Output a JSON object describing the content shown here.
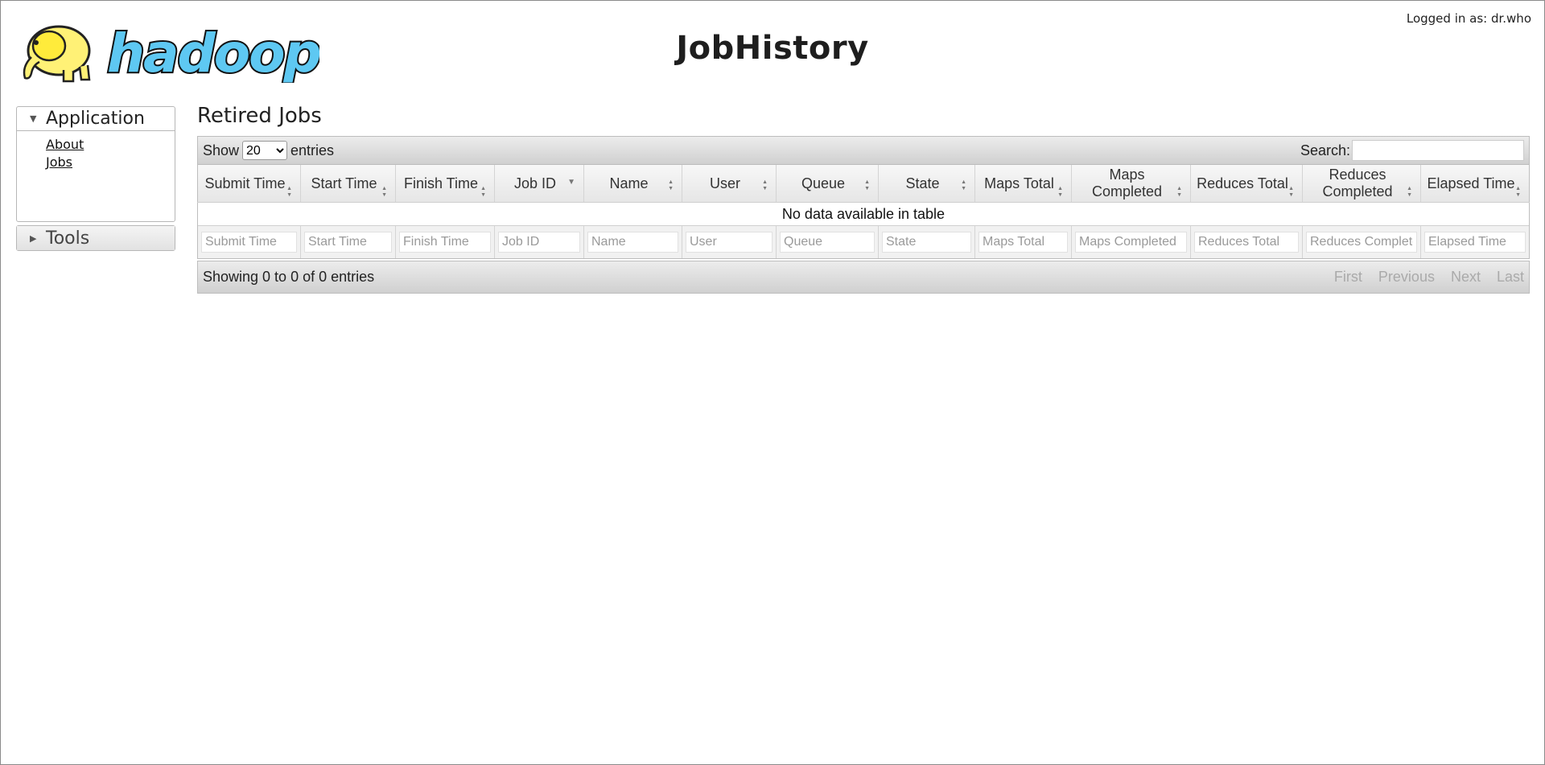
{
  "header": {
    "title": "JobHistory",
    "login": "Logged in as: dr.who",
    "logo_text": "hadoop"
  },
  "nav": {
    "application": {
      "label": "Application",
      "links": [
        "About",
        "Jobs"
      ]
    },
    "tools": {
      "label": "Tools"
    }
  },
  "main": {
    "title": "Retired Jobs",
    "length_prefix": "Show",
    "length_value": "20",
    "length_suffix": "entries",
    "search_label": "Search:",
    "search_value": "",
    "columns": [
      "Submit Time",
      "Start Time",
      "Finish Time",
      "Job ID",
      "Name",
      "User",
      "Queue",
      "State",
      "Maps Total",
      "Maps Completed",
      "Reduces Total",
      "Reduces Completed",
      "Elapsed Time"
    ],
    "sort_indicator_column": "Job ID",
    "empty_message": "No data available in table",
    "filter_placeholders": [
      "Submit Time",
      "Start Time",
      "Finish Time",
      "Job ID",
      "Name",
      "User",
      "Queue",
      "State",
      "Maps Total",
      "Maps Completed",
      "Reduces Total",
      "Reduces Completed",
      "Elapsed Time"
    ],
    "info": "Showing 0 to 0 of 0 entries",
    "pagination": [
      "First",
      "Previous",
      "Next",
      "Last"
    ]
  },
  "colors": {
    "logo_yellow": "#ffeb3b",
    "logo_blue": "#5ec8f2",
    "pager_disabled": "#aaaaaa"
  }
}
